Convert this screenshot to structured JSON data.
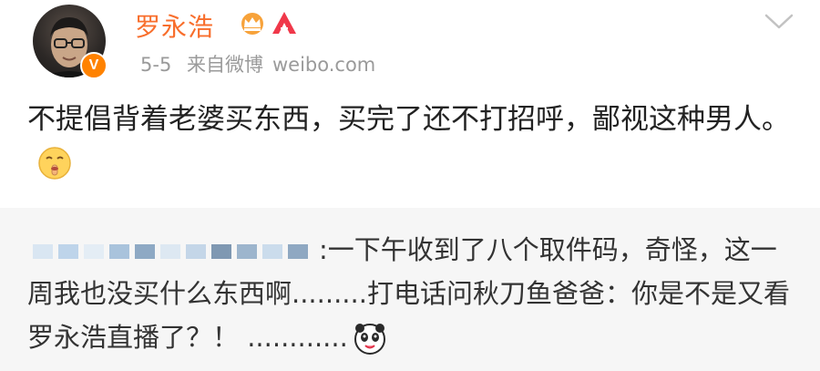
{
  "post": {
    "user_name": "罗永浩",
    "date": "5-5",
    "source": "来自微博",
    "source_site": "weibo.com",
    "verified_mark": "V",
    "text": "不提倡背着老婆买东西，买完了还不打招呼，鄙视这种男人。"
  },
  "repost": {
    "text": ":一下午收到了八个取件码，奇怪，这一周我也没买什么东西啊.........打电话问秋刀鱼爸爸：你是不是又看罗永浩直播了？！ ............"
  },
  "colors": {
    "name_orange": "#f86e2c",
    "badge_orange": "#ff8200",
    "meta_gray": "#9a9a9a",
    "repost_bg": "#f6f6f6"
  },
  "icons": {
    "crown": "crown-icon",
    "brand": "a-icon",
    "dropdown": "chevron-down-icon",
    "post_emoji": "shush-emoji-icon",
    "repost_emoji": "panda-emoji-icon"
  }
}
